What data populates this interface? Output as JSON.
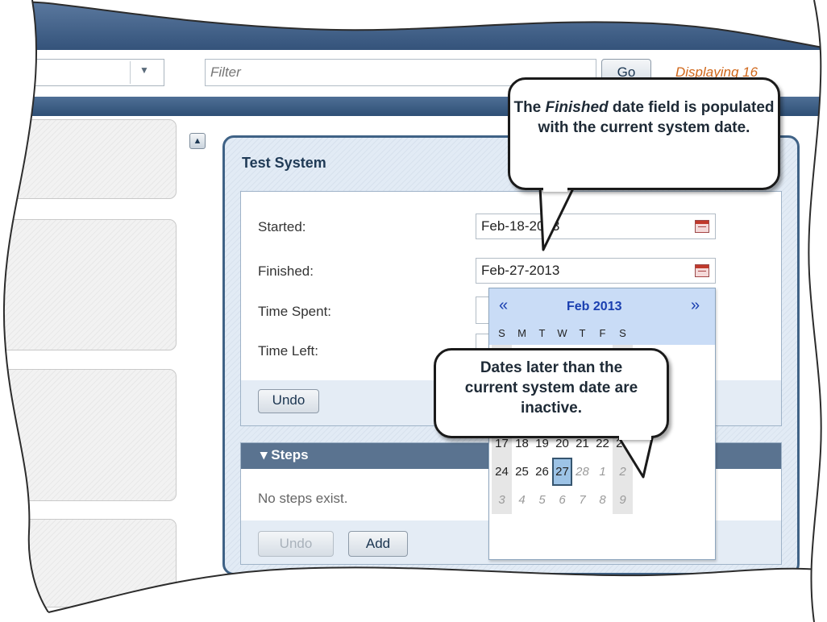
{
  "toolbar": {
    "dropdown_value": "",
    "filter_placeholder": "Filter",
    "go_label": "Go",
    "displaying_text": "Displaying 16"
  },
  "panel": {
    "title": "Test System",
    "started_label": "Started:",
    "started_value": "Feb-18-2013",
    "finished_label": "Finished:",
    "finished_value": "Feb-27-2013",
    "time_spent_label": "Time Spent:",
    "time_left_label": "Time Left:",
    "undo_label": "Undo"
  },
  "steps": {
    "header": "▾ Steps",
    "empty_text": "No steps exist.",
    "undo_label": "Undo",
    "add_label": "Add"
  },
  "calendar": {
    "prev": "«",
    "next": "»",
    "month_label": "Feb 2013",
    "weekdays": [
      "S",
      "M",
      "T",
      "W",
      "T",
      "F",
      "S"
    ]
  },
  "callouts": {
    "finished_prefix": "The ",
    "finished_em": "Finished",
    "finished_rest": " date field is populated with the current system date.",
    "inactive_text": "Dates later than the current system date are inactive."
  },
  "colors": {
    "header_navy": "#2e4f75",
    "steps_bar": "#5a7390",
    "accent_orange": "#d0671a",
    "calendar_header": "#c9dcf6",
    "selected_day": "#9dc3e6"
  }
}
